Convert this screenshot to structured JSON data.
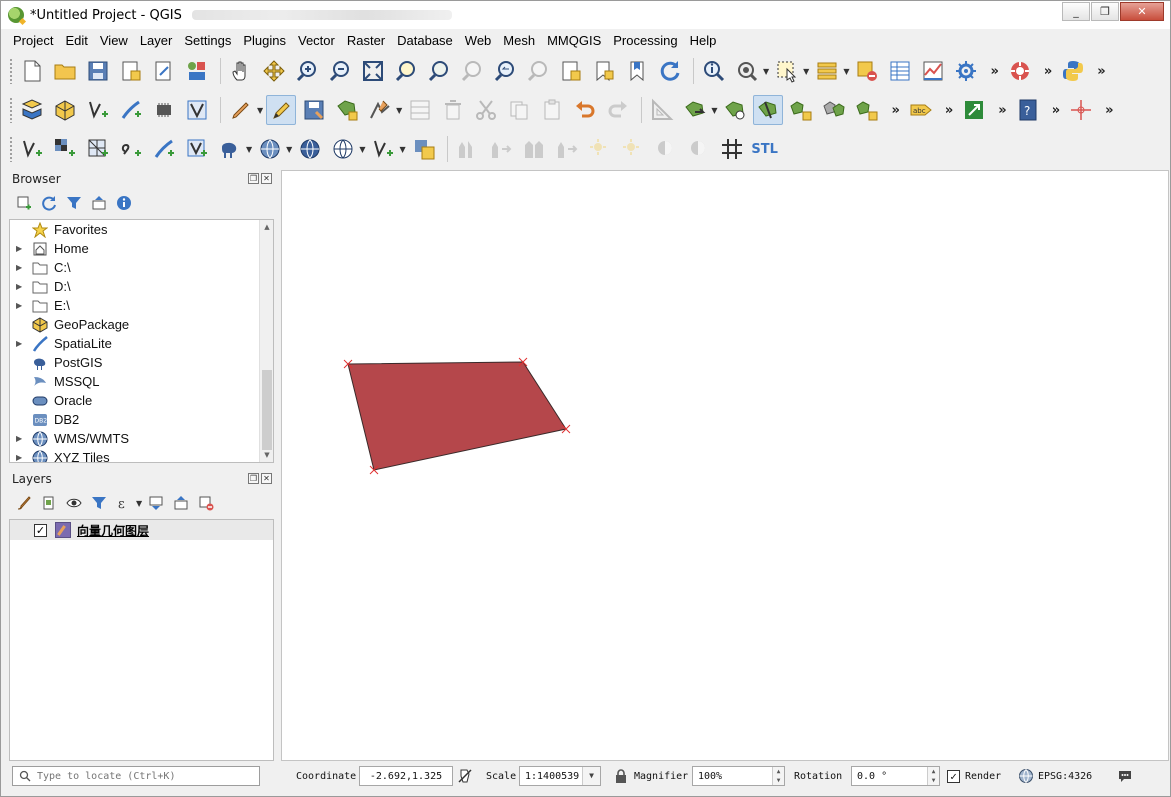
{
  "window": {
    "title": "*Untitled Project - QGIS",
    "buttons": [
      "_",
      "❐",
      "✕"
    ]
  },
  "menu": [
    "Project",
    "Edit",
    "View",
    "Layer",
    "Settings",
    "Plugins",
    "Vector",
    "Raster",
    "Database",
    "Web",
    "Mesh",
    "MMQGIS",
    "Processing",
    "Help"
  ],
  "toolbar_overflow": "»",
  "stl_label": "STL",
  "browser": {
    "title": "Browser",
    "items": [
      {
        "label": "Favorites",
        "icon": "star-icon",
        "expandable": false
      },
      {
        "label": "Home",
        "icon": "home-icon",
        "expandable": true
      },
      {
        "label": "C:\\",
        "icon": "folder-icon",
        "expandable": true
      },
      {
        "label": "D:\\",
        "icon": "folder-icon",
        "expandable": true
      },
      {
        "label": "E:\\",
        "icon": "folder-icon",
        "expandable": true
      },
      {
        "label": "GeoPackage",
        "icon": "geopackage-icon",
        "expandable": false
      },
      {
        "label": "SpatiaLite",
        "icon": "spatialite-icon",
        "expandable": true
      },
      {
        "label": "PostGIS",
        "icon": "postgis-icon",
        "expandable": false
      },
      {
        "label": "MSSQL",
        "icon": "mssql-icon",
        "expandable": false
      },
      {
        "label": "Oracle",
        "icon": "oracle-icon",
        "expandable": false
      },
      {
        "label": "DB2",
        "icon": "db2-icon",
        "expandable": false
      },
      {
        "label": "WMS/WMTS",
        "icon": "globe-icon",
        "expandable": true
      },
      {
        "label": "XYZ Tiles",
        "icon": "globe-icon",
        "expandable": true
      }
    ]
  },
  "layers": {
    "title": "Layers",
    "items": [
      {
        "name": "向量几何图层",
        "checked": true
      }
    ]
  },
  "map": {
    "polygon_fill": "#b5474b",
    "polygon_stroke": "#3a2a2a",
    "vertex_color": "#e03030"
  },
  "status": {
    "locator_placeholder": "Type to locate (Ctrl+K)",
    "coordinate_label": "Coordinate",
    "coordinate_value": "-2.692,1.325",
    "scale_label": "Scale",
    "scale_value": "1:1400539",
    "magnifier_label": "Magnifier",
    "magnifier_value": "100%",
    "rotation_label": "Rotation",
    "rotation_value": "0.0 °",
    "render_label": "Render",
    "render_checked": true,
    "crs_label": "EPSG:4326"
  }
}
